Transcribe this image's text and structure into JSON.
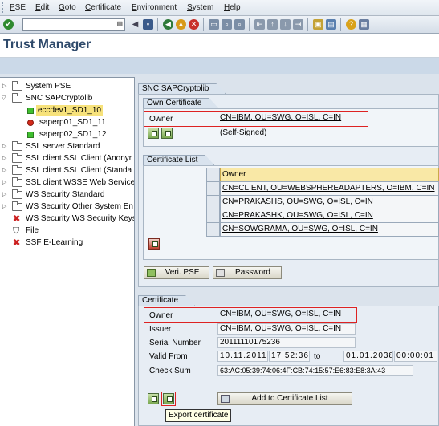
{
  "menu": [
    "PSE",
    "Edit",
    "Goto",
    "Certificate",
    "Environment",
    "System",
    "Help"
  ],
  "page_title": "Trust Manager",
  "tree": {
    "items": [
      {
        "label": "System PSE",
        "type": "folder",
        "expanded": false
      },
      {
        "label": "SNC SAPCryptolib",
        "type": "folder",
        "expanded": true
      },
      {
        "label": "eccdev1_SD1_10",
        "type": "green",
        "selected": true
      },
      {
        "label": "saperp01_SD1_11",
        "type": "red"
      },
      {
        "label": "saperp02_SD1_12",
        "type": "green"
      },
      {
        "label": "SSL server Standard",
        "type": "folder"
      },
      {
        "label": "SSL client SSL Client (Anonyr",
        "type": "folder"
      },
      {
        "label": "SSL client SSL Client (Standa",
        "type": "folder"
      },
      {
        "label": "SSL client WSSE Web Service",
        "type": "folder"
      },
      {
        "label": "WS Security Standard",
        "type": "folder"
      },
      {
        "label": "WS Security Other System En",
        "type": "folder"
      },
      {
        "label": "WS Security WS Security Keys",
        "type": "x"
      },
      {
        "label": "File",
        "type": "file"
      },
      {
        "label": "SSF E-Learning",
        "type": "x"
      }
    ]
  },
  "snc_panel": {
    "tab": "SNC SAPCryptolib",
    "own_cert_tab": "Own Certificate",
    "owner_label": "Owner",
    "owner_value": "CN=IBM, OU=SWG, O=ISL, C=IN",
    "self_signed": "(Self-Signed)",
    "cert_list_tab": "Certificate List",
    "cert_list_header": "Owner",
    "cert_list_rows": [
      "CN=CLIENT, OU=WEBSPHEREADAPTERS, O=IBM, C=IN",
      "CN=PRAKASHS, OU=SWG, O=ISL, C=IN",
      "CN=PRAKASHK, OU=SWG, O=ISL, C=IN",
      "CN=SOWGRAMA, OU=SWG, O=ISL, C=IN"
    ],
    "veri_pse_button": "Veri. PSE",
    "password_button": "Password"
  },
  "certificate": {
    "tab": "Certificate",
    "owner_label": "Owner",
    "owner_value": "CN=IBM, OU=SWG, O=ISL, C=IN",
    "issuer_label": "Issuer",
    "issuer_value": "CN=IBM, OU=SWG, O=ISL, C=IN",
    "serial_label": "Serial Number",
    "serial_value": "20111110175236",
    "valid_label": "Valid From",
    "valid_from_date": "10.11.2011",
    "valid_from_time": "17:52:36",
    "to_label": "to",
    "valid_to_date": "01.01.2038",
    "valid_to_time": "00:00:01",
    "checksum_label": "Check Sum",
    "checksum_value": "63:AC:05:39:74:06:4F:CB:74:15:57:E6:83:E8:3A:43",
    "add_button": "Add to Certificate List",
    "tooltip": "Export certificate"
  }
}
